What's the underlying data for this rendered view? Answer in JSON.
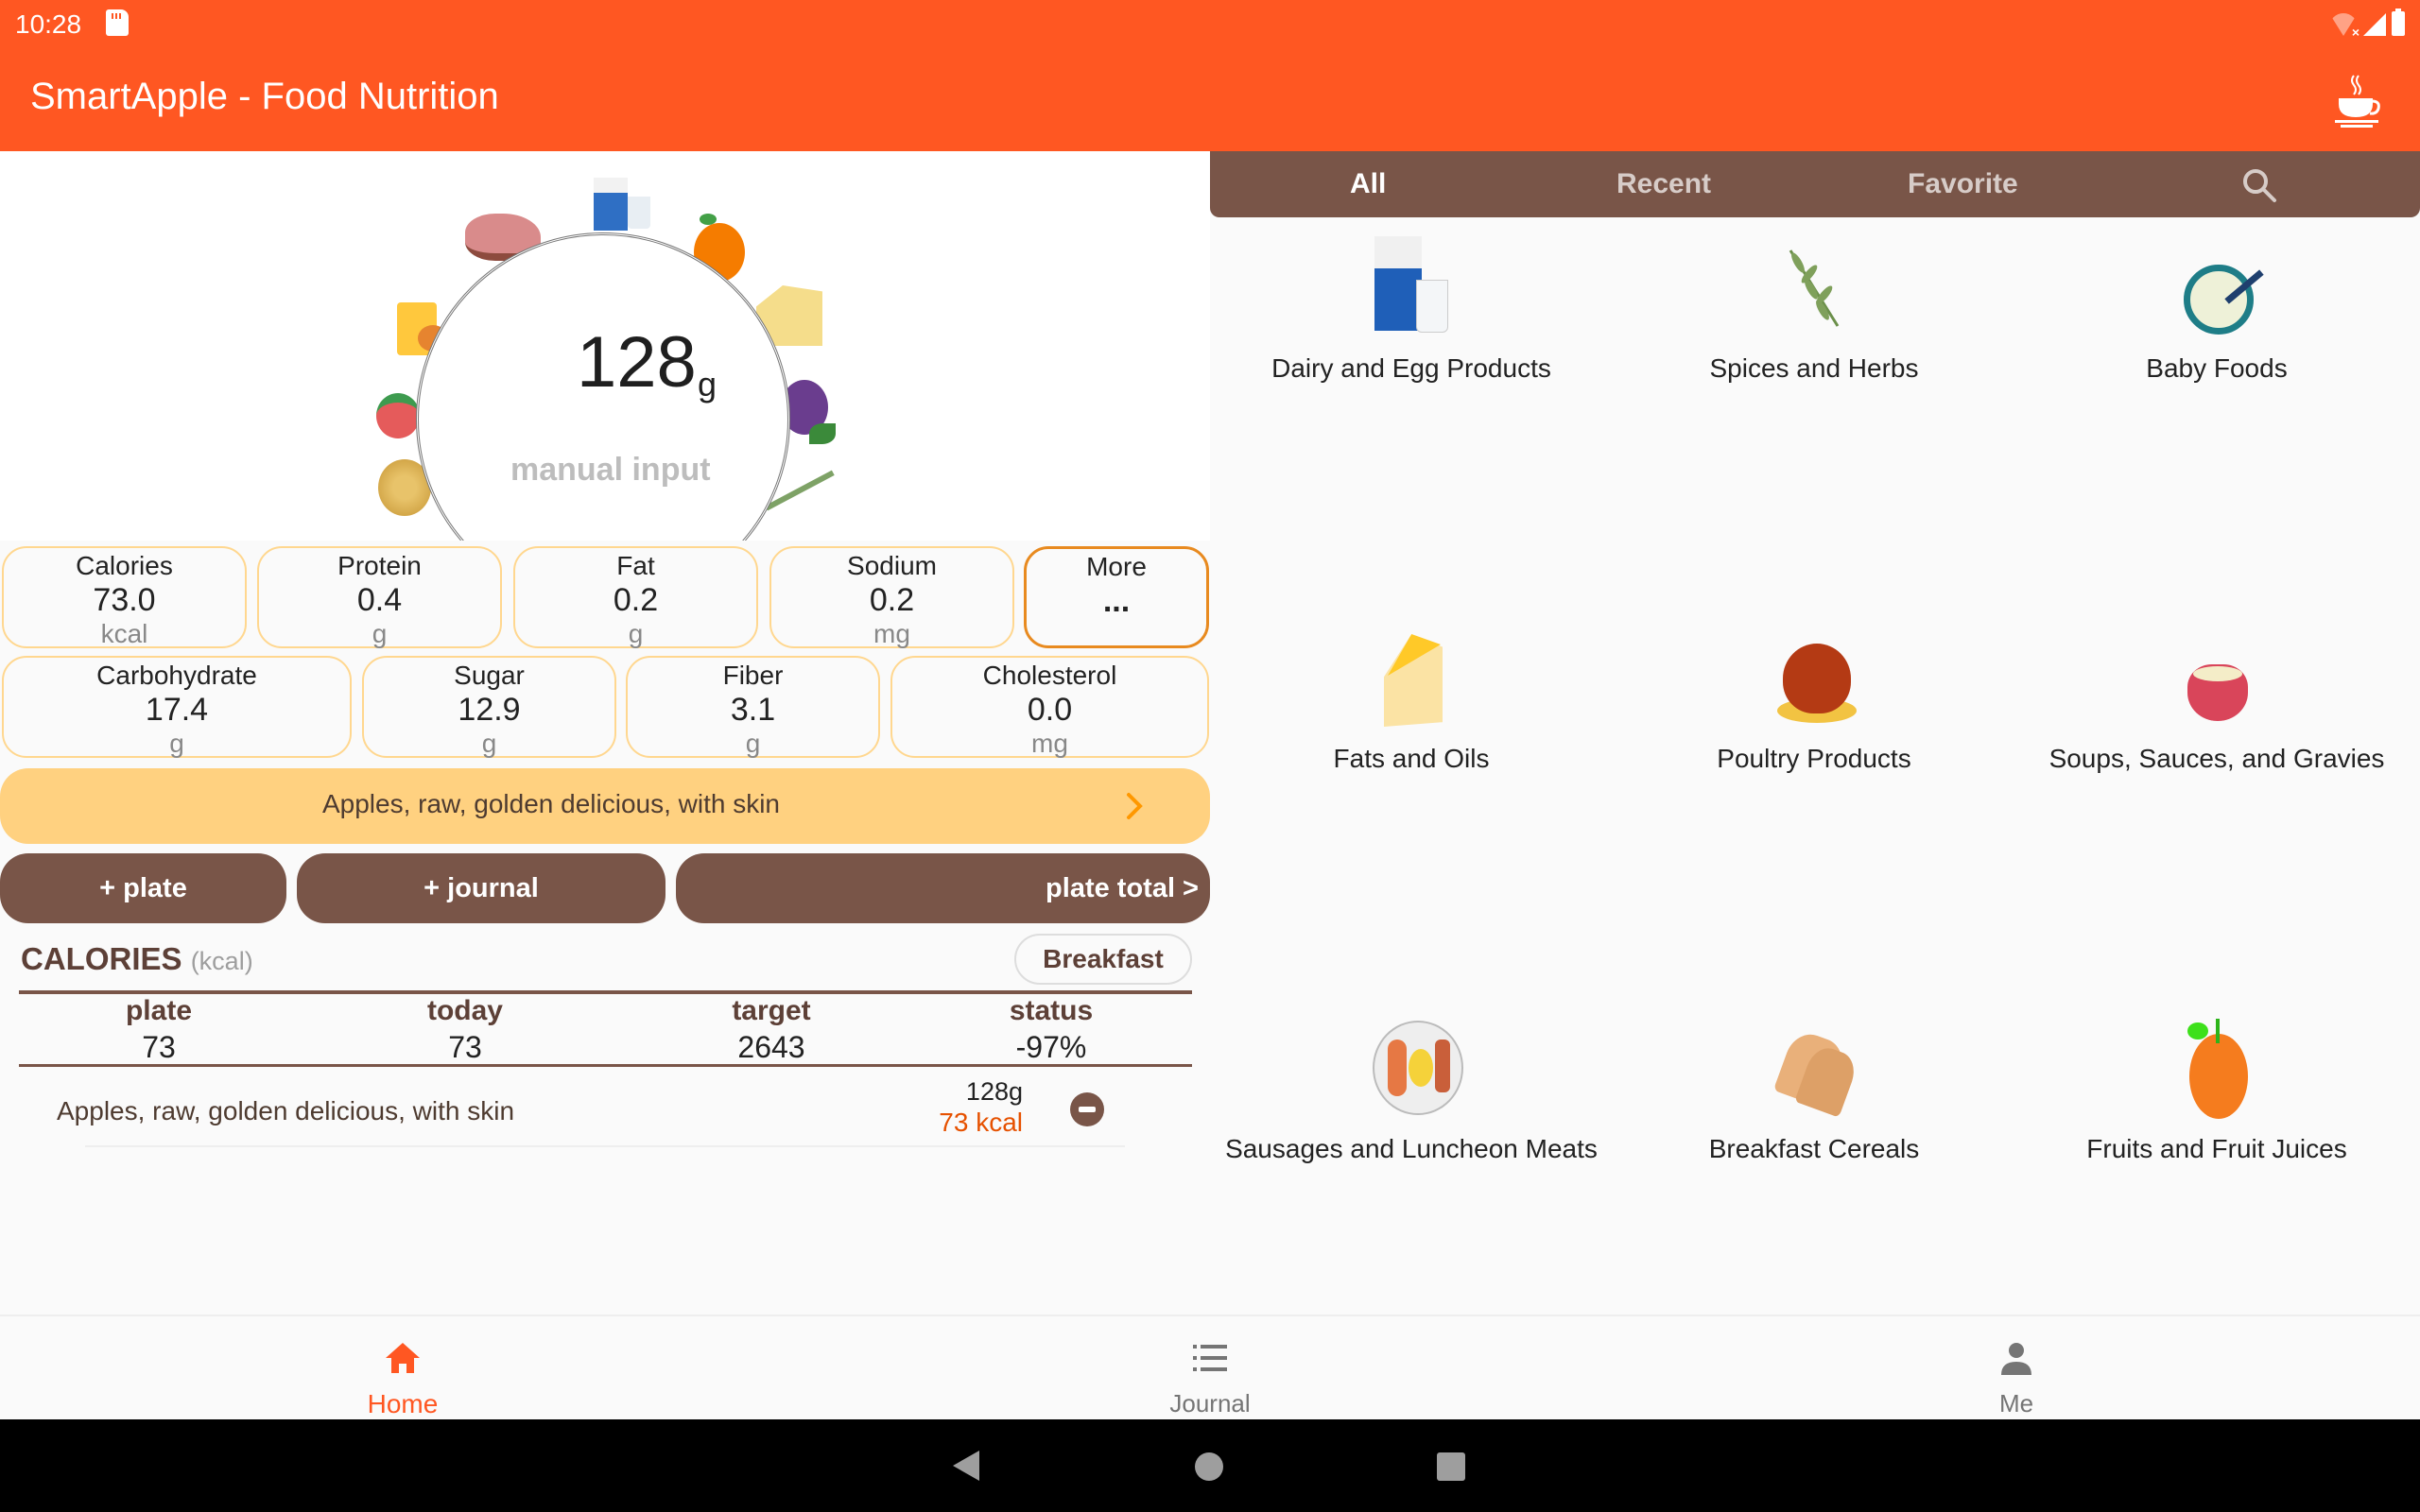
{
  "status_bar": {
    "time": "10:28"
  },
  "app_bar": {
    "title": "SmartApple - Food Nutrition"
  },
  "scale": {
    "weight": "128",
    "unit": "g",
    "manual_input_label": "manual input"
  },
  "nutrients_row1": [
    {
      "label": "Calories",
      "value": "73.0",
      "unit": "kcal"
    },
    {
      "label": "Protein",
      "value": "0.4",
      "unit": "g"
    },
    {
      "label": "Fat",
      "value": "0.2",
      "unit": "g"
    },
    {
      "label": "Sodium",
      "value": "0.2",
      "unit": "mg"
    },
    {
      "label": "More",
      "value": "...",
      "unit": ""
    }
  ],
  "nutrients_row2": [
    {
      "label": "Carbohydrate",
      "value": "17.4",
      "unit": "g"
    },
    {
      "label": "Sugar",
      "value": "12.9",
      "unit": "g"
    },
    {
      "label": "Fiber",
      "value": "3.1",
      "unit": "g"
    },
    {
      "label": "Cholesterol",
      "value": "0.0",
      "unit": "mg"
    }
  ],
  "selected_food": {
    "name": "Apples, raw, golden delicious, with skin"
  },
  "actions": {
    "add_plate": "+ plate",
    "add_journal": "+ journal",
    "plate_total": "plate total >"
  },
  "calories": {
    "title": "CALORIES",
    "unit": "(kcal)",
    "meal": "Breakfast",
    "columns": [
      {
        "header": "plate",
        "value": "73"
      },
      {
        "header": "today",
        "value": "73"
      },
      {
        "header": "target",
        "value": "2643"
      },
      {
        "header": "status",
        "value": "-97%"
      }
    ],
    "items": [
      {
        "name": "Apples, raw, golden delicious, with skin",
        "weight": "128g",
        "kcal": "73 kcal"
      }
    ]
  },
  "tabs": [
    {
      "label": "All",
      "active": true
    },
    {
      "label": "Recent",
      "active": false
    },
    {
      "label": "Favorite",
      "active": false
    }
  ],
  "categories": [
    {
      "label": "Dairy and Egg Products",
      "icon": "milk-carton-icon"
    },
    {
      "label": "Spices and Herbs",
      "icon": "herb-sprig-icon"
    },
    {
      "label": "Baby Foods",
      "icon": "cereal-bowl-icon"
    },
    {
      "label": "Fats and Oils",
      "icon": "cheese-icon"
    },
    {
      "label": "Poultry Products",
      "icon": "roast-chicken-icon"
    },
    {
      "label": "Soups, Sauces, and Gravies",
      "icon": "soup-bowl-icon"
    },
    {
      "label": "Sausages and Luncheon Meats",
      "icon": "breakfast-plate-icon"
    },
    {
      "label": "Breakfast Cereals",
      "icon": "bread-icon"
    },
    {
      "label": "Fruits and Fruit Juices",
      "icon": "orange-icon"
    }
  ],
  "bottom_nav": [
    {
      "label": "Home",
      "active": true
    },
    {
      "label": "Journal",
      "active": false
    },
    {
      "label": "Me",
      "active": false
    }
  ],
  "colors": {
    "primary": "#ff5722",
    "brown": "#795548",
    "name_bar": "#ffd180",
    "card_border": "#ffd78f",
    "more_border": "#e88a1f",
    "kcal_text": "#e65100"
  }
}
